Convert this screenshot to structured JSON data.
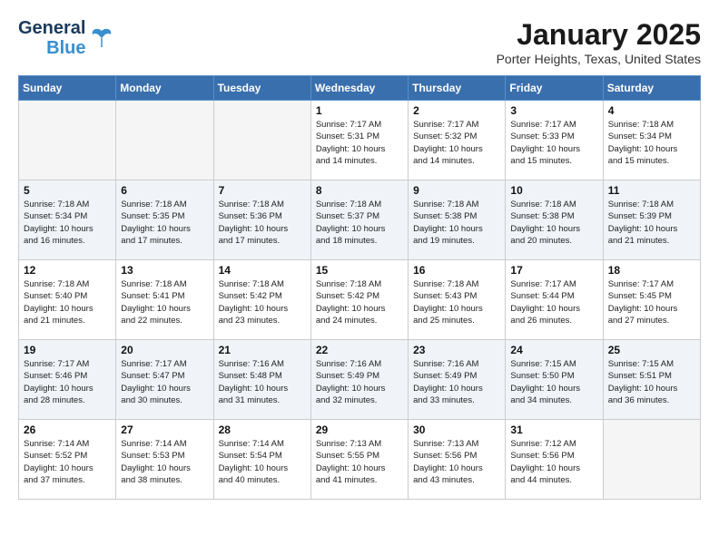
{
  "header": {
    "logo_line1": "General",
    "logo_line2": "Blue",
    "month": "January 2025",
    "location": "Porter Heights, Texas, United States"
  },
  "weekdays": [
    "Sunday",
    "Monday",
    "Tuesday",
    "Wednesday",
    "Thursday",
    "Friday",
    "Saturday"
  ],
  "weeks": [
    [
      {
        "day": "",
        "info": ""
      },
      {
        "day": "",
        "info": ""
      },
      {
        "day": "",
        "info": ""
      },
      {
        "day": "1",
        "info": "Sunrise: 7:17 AM\nSunset: 5:31 PM\nDaylight: 10 hours\nand 14 minutes."
      },
      {
        "day": "2",
        "info": "Sunrise: 7:17 AM\nSunset: 5:32 PM\nDaylight: 10 hours\nand 14 minutes."
      },
      {
        "day": "3",
        "info": "Sunrise: 7:17 AM\nSunset: 5:33 PM\nDaylight: 10 hours\nand 15 minutes."
      },
      {
        "day": "4",
        "info": "Sunrise: 7:18 AM\nSunset: 5:34 PM\nDaylight: 10 hours\nand 15 minutes."
      }
    ],
    [
      {
        "day": "5",
        "info": "Sunrise: 7:18 AM\nSunset: 5:34 PM\nDaylight: 10 hours\nand 16 minutes."
      },
      {
        "day": "6",
        "info": "Sunrise: 7:18 AM\nSunset: 5:35 PM\nDaylight: 10 hours\nand 17 minutes."
      },
      {
        "day": "7",
        "info": "Sunrise: 7:18 AM\nSunset: 5:36 PM\nDaylight: 10 hours\nand 17 minutes."
      },
      {
        "day": "8",
        "info": "Sunrise: 7:18 AM\nSunset: 5:37 PM\nDaylight: 10 hours\nand 18 minutes."
      },
      {
        "day": "9",
        "info": "Sunrise: 7:18 AM\nSunset: 5:38 PM\nDaylight: 10 hours\nand 19 minutes."
      },
      {
        "day": "10",
        "info": "Sunrise: 7:18 AM\nSunset: 5:38 PM\nDaylight: 10 hours\nand 20 minutes."
      },
      {
        "day": "11",
        "info": "Sunrise: 7:18 AM\nSunset: 5:39 PM\nDaylight: 10 hours\nand 21 minutes."
      }
    ],
    [
      {
        "day": "12",
        "info": "Sunrise: 7:18 AM\nSunset: 5:40 PM\nDaylight: 10 hours\nand 21 minutes."
      },
      {
        "day": "13",
        "info": "Sunrise: 7:18 AM\nSunset: 5:41 PM\nDaylight: 10 hours\nand 22 minutes."
      },
      {
        "day": "14",
        "info": "Sunrise: 7:18 AM\nSunset: 5:42 PM\nDaylight: 10 hours\nand 23 minutes."
      },
      {
        "day": "15",
        "info": "Sunrise: 7:18 AM\nSunset: 5:42 PM\nDaylight: 10 hours\nand 24 minutes."
      },
      {
        "day": "16",
        "info": "Sunrise: 7:18 AM\nSunset: 5:43 PM\nDaylight: 10 hours\nand 25 minutes."
      },
      {
        "day": "17",
        "info": "Sunrise: 7:17 AM\nSunset: 5:44 PM\nDaylight: 10 hours\nand 26 minutes."
      },
      {
        "day": "18",
        "info": "Sunrise: 7:17 AM\nSunset: 5:45 PM\nDaylight: 10 hours\nand 27 minutes."
      }
    ],
    [
      {
        "day": "19",
        "info": "Sunrise: 7:17 AM\nSunset: 5:46 PM\nDaylight: 10 hours\nand 28 minutes."
      },
      {
        "day": "20",
        "info": "Sunrise: 7:17 AM\nSunset: 5:47 PM\nDaylight: 10 hours\nand 30 minutes."
      },
      {
        "day": "21",
        "info": "Sunrise: 7:16 AM\nSunset: 5:48 PM\nDaylight: 10 hours\nand 31 minutes."
      },
      {
        "day": "22",
        "info": "Sunrise: 7:16 AM\nSunset: 5:49 PM\nDaylight: 10 hours\nand 32 minutes."
      },
      {
        "day": "23",
        "info": "Sunrise: 7:16 AM\nSunset: 5:49 PM\nDaylight: 10 hours\nand 33 minutes."
      },
      {
        "day": "24",
        "info": "Sunrise: 7:15 AM\nSunset: 5:50 PM\nDaylight: 10 hours\nand 34 minutes."
      },
      {
        "day": "25",
        "info": "Sunrise: 7:15 AM\nSunset: 5:51 PM\nDaylight: 10 hours\nand 36 minutes."
      }
    ],
    [
      {
        "day": "26",
        "info": "Sunrise: 7:14 AM\nSunset: 5:52 PM\nDaylight: 10 hours\nand 37 minutes."
      },
      {
        "day": "27",
        "info": "Sunrise: 7:14 AM\nSunset: 5:53 PM\nDaylight: 10 hours\nand 38 minutes."
      },
      {
        "day": "28",
        "info": "Sunrise: 7:14 AM\nSunset: 5:54 PM\nDaylight: 10 hours\nand 40 minutes."
      },
      {
        "day": "29",
        "info": "Sunrise: 7:13 AM\nSunset: 5:55 PM\nDaylight: 10 hours\nand 41 minutes."
      },
      {
        "day": "30",
        "info": "Sunrise: 7:13 AM\nSunset: 5:56 PM\nDaylight: 10 hours\nand 43 minutes."
      },
      {
        "day": "31",
        "info": "Sunrise: 7:12 AM\nSunset: 5:56 PM\nDaylight: 10 hours\nand 44 minutes."
      },
      {
        "day": "",
        "info": ""
      }
    ]
  ]
}
